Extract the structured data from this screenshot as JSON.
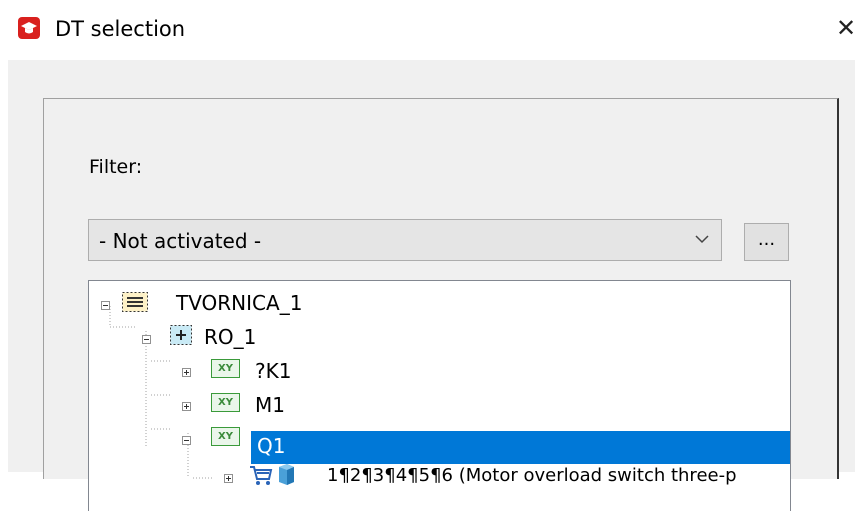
{
  "window": {
    "title": "DT selection",
    "close_glyph": "✕"
  },
  "filter": {
    "label": "Filter:",
    "selected": "- Not activated -",
    "more_label": "..."
  },
  "tree": {
    "nodes": [
      {
        "label": "TVORNICA_1",
        "icon": "structure-list-icon",
        "expanded": true
      },
      {
        "label": "RO_1",
        "icon": "location-plus-icon",
        "expanded": true
      },
      {
        "label": "?K1",
        "icon": "xy-device-icon",
        "badge": "XY",
        "expanded": false
      },
      {
        "label": "M1",
        "icon": "xy-device-icon",
        "badge": "XY",
        "expanded": false
      },
      {
        "label": "Q1",
        "icon": "xy-device-icon",
        "badge": "XY",
        "expanded": true,
        "selected": true
      },
      {
        "label": "1¶2¶3¶4¶5¶6 (Motor overload switch three-p",
        "icon": "cart-part-icon",
        "expanded": false
      }
    ]
  },
  "colors": {
    "accent": "#0078d7",
    "app_icon": "#d9201e"
  }
}
